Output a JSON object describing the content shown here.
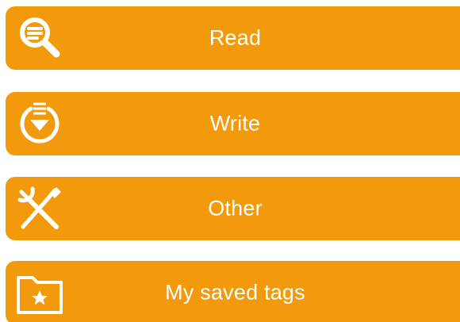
{
  "theme": {
    "button_color": "#f29a0c",
    "icon_color": "#ffffff",
    "text_color": "#ffffff"
  },
  "menu": {
    "items": [
      {
        "label": "Read",
        "icon": "search-list-icon"
      },
      {
        "label": "Write",
        "icon": "download-circle-icon"
      },
      {
        "label": "Other",
        "icon": "tools-icon"
      },
      {
        "label": "My saved tags",
        "icon": "star-folder-icon"
      }
    ]
  }
}
